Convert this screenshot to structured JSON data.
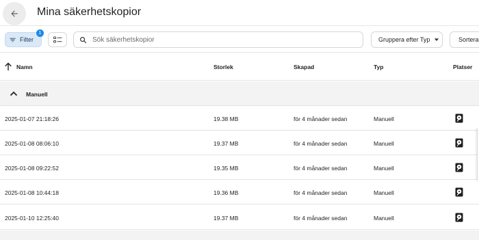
{
  "header": {
    "title": "Mina säkerhetskopior",
    "back_icon": "arrow-left-icon"
  },
  "toolbar": {
    "filter_label": "Filter",
    "filter_badge": "1",
    "search_placeholder": "Sök säkerhetskopior",
    "search_value": "",
    "group_label": "Gruppera efter Typ",
    "sort_label": "Sortera"
  },
  "table": {
    "columns": {
      "name": "Namn",
      "size": "Storlek",
      "created": "Skapad",
      "type": "Typ",
      "locations": "Platser"
    },
    "group": {
      "label": "Manuell",
      "expanded": true
    },
    "rows": [
      {
        "name": "2025-01-07 21:18:26",
        "size": "19.38 MB",
        "created": "för 4 månader sedan",
        "type": "Manuell",
        "location_icon": "harddisk-icon"
      },
      {
        "name": "2025-01-08 08:06:10",
        "size": "19.37 MB",
        "created": "för 4 månader sedan",
        "type": "Manuell",
        "location_icon": "harddisk-icon"
      },
      {
        "name": "2025-01-08 09:22:52",
        "size": "19.35 MB",
        "created": "för 4 månader sedan",
        "type": "Manuell",
        "location_icon": "harddisk-icon"
      },
      {
        "name": "2025-01-08 10:44:18",
        "size": "19.36 MB",
        "created": "för 4 månader sedan",
        "type": "Manuell",
        "location_icon": "harddisk-icon"
      },
      {
        "name": "2025-01-10 12:25:40",
        "size": "19.37 MB",
        "created": "för 4 månader sedan",
        "type": "Manuell",
        "location_icon": "harddisk-icon"
      }
    ]
  },
  "colors": {
    "accent": "#1f88e5",
    "filter_active_bg": "#dbe9f7",
    "group_row_bg": "#f3f3f3"
  }
}
